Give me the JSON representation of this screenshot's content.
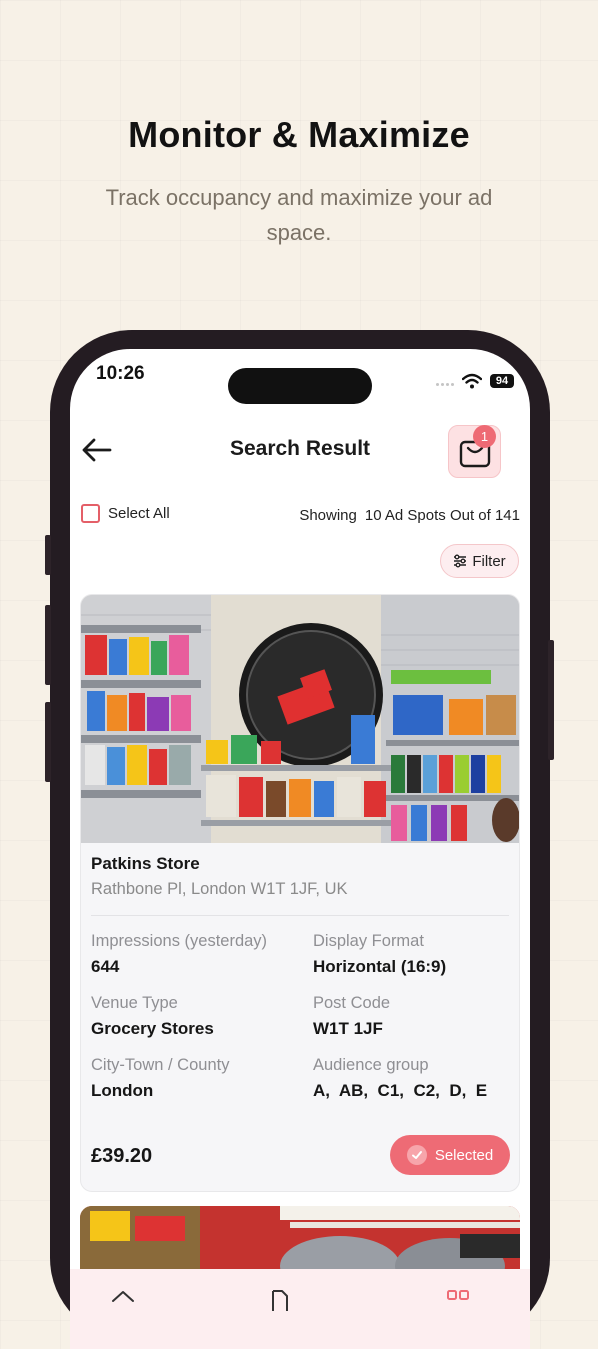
{
  "promo": {
    "headline": "Monitor & Maximize",
    "subline": "Track occupancy and maximize your ad space."
  },
  "status_bar": {
    "time": "10:26",
    "battery": "94"
  },
  "header": {
    "title": "Search Result",
    "cart_count": "1"
  },
  "toolbar": {
    "select_all": "Select All",
    "showing_label": "Showing",
    "showing_value": "10 Ad Spots Out of 141",
    "filter": "Filter"
  },
  "listing": {
    "name": "Patkins Store",
    "address": "Rathbone Pl, London W1T 1JF, UK",
    "fields": {
      "impressions_label": "Impressions (yesterday)",
      "impressions_value": "644",
      "format_label": "Display Format",
      "format_value": "Horizontal (16:9)",
      "venue_label": "Venue Type",
      "venue_value": "Grocery Stores",
      "postcode_label": "Post Code",
      "postcode_value": "W1T 1JF",
      "city_label": "City-Town / County",
      "city_value": "London",
      "audience_label": "Audience group",
      "audience_value": "A,  AB,  C1,  C2,  D,  E"
    },
    "price": "£39.20",
    "selected_label": "Selected"
  },
  "colors": {
    "accent": "#ee6b75",
    "accent_light": "#fde1e3",
    "background": "#f7f1e7"
  },
  "icons": [
    "back-arrow-icon",
    "shopping-bag-icon",
    "filter-sliders-icon",
    "check-icon",
    "home-icon",
    "document-icon",
    "grid-icon",
    "wifi-icon"
  ]
}
